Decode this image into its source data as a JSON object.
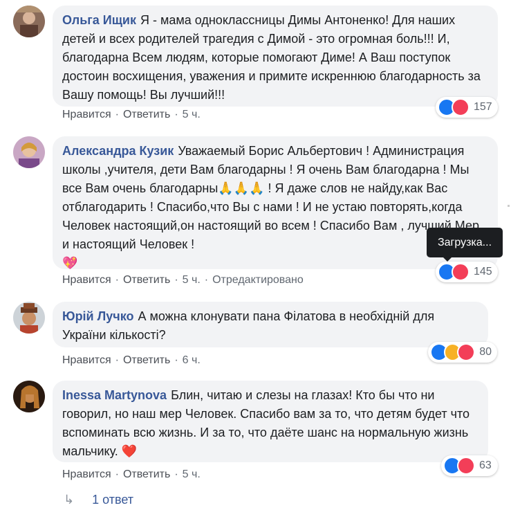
{
  "comments": [
    {
      "author": "Ольга Ищик",
      "text": "Я - мама одноклассницы Димы Антоненко! Для наших детей и всех родителей трагедия с Димой - это огромная боль!!! И, благодарна Всем людям, которые помогают Диме! А Ваш поступок достоин восхищения, уважения и примите искреннюю благодарность за Вашу помощь! Вы лучший!!!",
      "like": "Нравится",
      "reply": "Ответить",
      "time": "5 ч.",
      "reaction_count": "157"
    },
    {
      "author": "Александра Кузик",
      "text": "Уважаемый Борис Альбертович ! Администрация школы ,учителя, дети Вам благодарны ! Я очень Вам благодарна ! Мы все Вам очень благодарны🙏🙏🙏 ! Я даже слов не найду,как Вас отблагодарить ! Спасибо,что Вы с нами ! И не устаю повторять,когда Человек настоящий,он настоящий во всем ! Спасибо Вам , лучший Мер и настоящий Человек !",
      "emoji": "💖",
      "like": "Нравится",
      "reply": "Ответить",
      "time": "5 ч.",
      "edited": "Отредактировано",
      "reaction_count": "145"
    },
    {
      "author": "Юрій Лучко",
      "text": "А можна клонувати пана Філатова в необхідній для України кількості?",
      "like": "Нравится",
      "reply": "Ответить",
      "time": "6 ч.",
      "reaction_count": "80"
    },
    {
      "author": "Inessa Martynova",
      "text": "Блин, читаю и слезы на глазах! Кто бы что ни говорил, но наш мер Человек. Спасибо вам за то, что детям будет что вспоминать всю жизнь. И за то, что даёте шанс на нормальную жизнь мальчику.",
      "emoji": "❤️",
      "like": "Нравится",
      "reply": "Ответить",
      "time": "5 ч.",
      "reaction_count": "63"
    }
  ],
  "tooltip": "Загрузка...",
  "replies_link": "1 ответ",
  "colors": {
    "author": "#385898",
    "bubble": "#f2f3f5",
    "like": "#1877f2",
    "love": "#f33e58",
    "haha": "#f7b125"
  }
}
